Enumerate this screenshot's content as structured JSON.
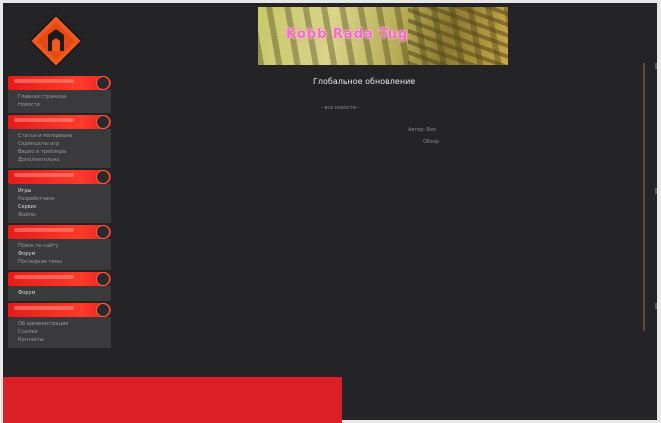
{
  "banner": {
    "text": "Kobb Rada Tug"
  },
  "content": {
    "title": "Глобальное обновление",
    "link": "- все новости -",
    "meta1": "Автор: Ben",
    "meta2": "Обзор"
  },
  "sidebar": {
    "sections": [
      {
        "items": [
          "Главная страница",
          "Новости"
        ]
      },
      {
        "items": [
          "Статьи и материалы",
          "Скриншоты игр",
          "Видео и трейлеры",
          "Дополнительно"
        ]
      },
      {
        "items": [
          "Игры",
          "Разработчики",
          "Сервис",
          "Файлы"
        ]
      },
      {
        "items": [
          "Поиск по сайту",
          "Форум",
          "Последние темы"
        ]
      },
      {
        "items": [
          "Форум"
        ]
      },
      {
        "items": [
          "Об администрации",
          "Ссылки",
          "Контакты"
        ]
      }
    ]
  },
  "colors": {
    "accent": "#e51b1b",
    "background": "#242426",
    "bottom_block": "#da1f26"
  }
}
